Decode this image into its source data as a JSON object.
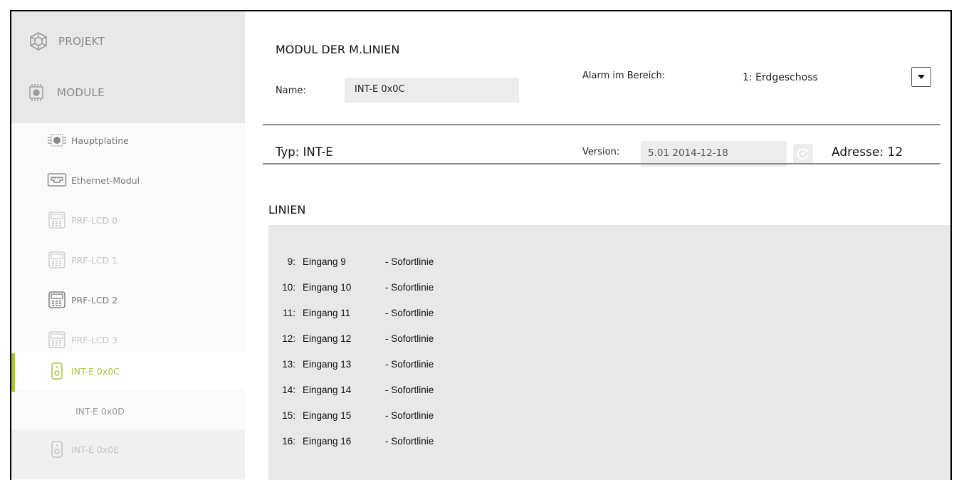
{
  "sidebar": {
    "projekt_label": "PROJEKT",
    "module_label": "MODULE",
    "items": [
      {
        "label": "Hauptplatine",
        "icon": "mainboard-icon"
      },
      {
        "label": "Ethernet-Modul",
        "icon": "ethernet-icon"
      },
      {
        "label": "PRF-LCD 0",
        "icon": "keypad-icon"
      },
      {
        "label": "PRF-LCD 1",
        "icon": "keypad-icon"
      },
      {
        "label": "PRF-LCD 2",
        "icon": "keypad-icon"
      },
      {
        "label": "PRF-LCD 3",
        "icon": "keypad-icon"
      },
      {
        "label": "INT-E 0x0C",
        "icon": "expander-icon"
      },
      {
        "label": "INT-E 0x0D",
        "icon": ""
      },
      {
        "label": "INT-E 0x0E",
        "icon": "expander-icon"
      }
    ],
    "accent_color": "#a9c23f"
  },
  "header": {
    "title": "MODUL DER M.LINIEN",
    "name_label": "Name:",
    "name_value": "INT-E 0x0C",
    "alarm_label": "Alarm im Bereich:",
    "alarm_value": "1: Erdgeschoss"
  },
  "info": {
    "typ": "Typ:  INT-E",
    "version_label": "Version:",
    "version_value": "5.01 2014-12-18",
    "adresse": "Adresse: 12"
  },
  "linien": {
    "title": "LINIEN",
    "rows": [
      {
        "num": "9:",
        "name": "Eingang 9",
        "type": "- Sofortlinie"
      },
      {
        "num": "10:",
        "name": "Eingang 10",
        "type": "- Sofortlinie"
      },
      {
        "num": "11:",
        "name": "Eingang 11",
        "type": "- Sofortlinie"
      },
      {
        "num": "12:",
        "name": "Eingang 12",
        "type": "- Sofortlinie"
      },
      {
        "num": "13:",
        "name": "Eingang 13",
        "type": "- Sofortlinie"
      },
      {
        "num": "14:",
        "name": "Eingang 14",
        "type": "- Sofortlinie"
      },
      {
        "num": "15:",
        "name": "Eingang 15",
        "type": "- Sofortlinie"
      },
      {
        "num": "16:",
        "name": "Eingang 16",
        "type": "- Sofortlinie"
      }
    ]
  }
}
